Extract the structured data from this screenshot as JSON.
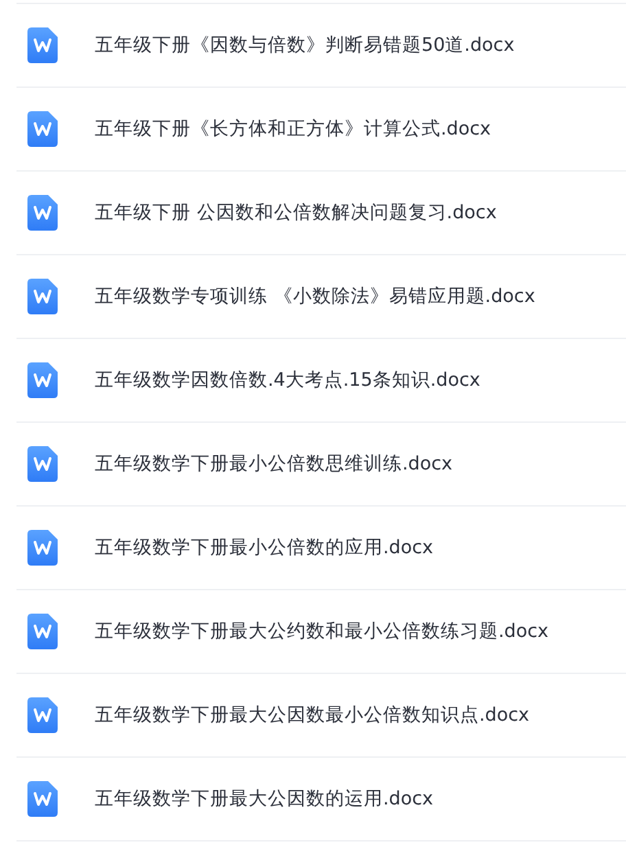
{
  "files": [
    {
      "name": "五年级下册《因数与倍数》判断易错题50道.docx"
    },
    {
      "name": "五年级下册《长方体和正方体》计算公式.docx"
    },
    {
      "name": "五年级下册 公因数和公倍数解决问题复习.docx"
    },
    {
      "name": "五年级数学专项训练 《小数除法》易错应用题.docx"
    },
    {
      "name": "五年级数学因数倍数.4大考点.15条知识.docx"
    },
    {
      "name": "五年级数学下册最小公倍数思维训练.docx"
    },
    {
      "name": "五年级数学下册最小公倍数的应用.docx"
    },
    {
      "name": "五年级数学下册最大公约数和最小公倍数练习题.docx"
    },
    {
      "name": "五年级数学下册最大公因数最小公倍数知识点.docx"
    },
    {
      "name": "五年级数学下册最大公因数的运用.docx"
    }
  ]
}
